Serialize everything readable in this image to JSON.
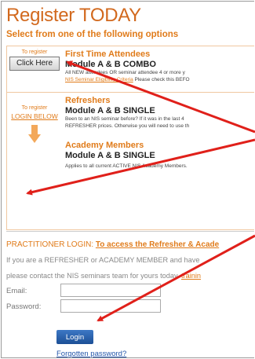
{
  "header": {
    "title": "Register TODAY",
    "subtitle": "Select from one of the following options"
  },
  "first_time": {
    "side_label": "To register",
    "button_label": "Click Here",
    "title": "First Time Attendees",
    "module": "Module A & B COMBO",
    "desc_start": "All NEW ",
    "desc_mid": "attendees OR seminar attendee 4 or more y",
    "link": "NIS Seminar Eligibility Criteria",
    "desc_end": " Please check this BEFO"
  },
  "refreshers": {
    "side_label": "To register",
    "side_link": "LOGIN BELOW",
    "title": "Refreshers",
    "module": "Module A & B SINGLE",
    "desc_line1": "Been to an NIS seminar before? If it was in the last 4",
    "desc_line2": "REFRESHER prices. Otherwise you will need to use th"
  },
  "academy": {
    "title": "Academy Members",
    "module": "Module A & B SINGLE",
    "desc": "Applies to all current ACTIVE NIS Academy Members."
  },
  "login": {
    "heading": "PRACTITIONER LOGIN: ",
    "heading_link": "To access the Refresher & Acade",
    "info_line1": "If you are a REFRESHER or ACADEMY MEMBER and have",
    "info_line2": "please contact the NIS seminars team for yours today. ",
    "info_link": "trainin",
    "email_label": "Email:",
    "email_value": "",
    "password_label": "Password:",
    "password_value": "",
    "button_label": "Login",
    "forgot_link": "Forgotten password?"
  },
  "colors": {
    "accent_orange": "#e07b1a",
    "title_orange": "#d2691e",
    "annotation_red": "#e0201a",
    "button_blue": "#2a5fa8"
  }
}
